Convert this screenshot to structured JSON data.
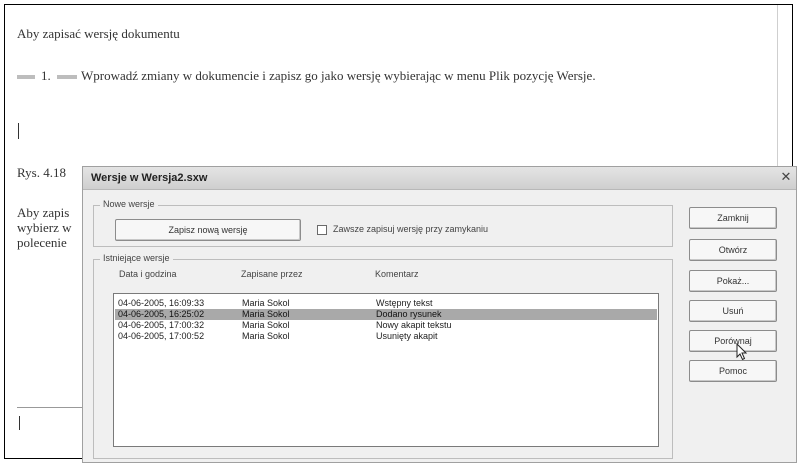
{
  "document": {
    "line1": "Aby zapisać wersję dokumentu",
    "step_number": "1.",
    "step_text": "Wprowadź zmiany w dokumencie i zapisz go jako wersję wybierając w menu Plik pozycję Wersje.",
    "figure_caption": "Rys. 4.18",
    "para2_line1": "Aby zapis",
    "para2_line2": "wybierz w",
    "para2_line3": "polecenie"
  },
  "dialog": {
    "title": "Wersje w Wersja2.sxw",
    "close_glyph": "✕",
    "new_group_label": "Nowe wersje",
    "save_new_button": "Zapisz nową wersję",
    "autosave_label": "Zawsze zapisuj wersję przy zamykaniu",
    "autosave_checked": false,
    "existing_group_label": "Istniejące wersje",
    "columns": {
      "date": "Data i godzina",
      "by": "Zapisane przez",
      "comment": "Komentarz"
    },
    "rows": [
      {
        "date": "04-06-2005, 16:09:33",
        "by": "Maria Sokol",
        "comment": "Wstępny tekst",
        "selected": false
      },
      {
        "date": "04-06-2005, 16:25:02",
        "by": "Maria Sokol",
        "comment": "Dodano rysunek",
        "selected": true
      },
      {
        "date": "04-06-2005, 17:00:32",
        "by": "Maria Sokol",
        "comment": "Nowy akapit tekstu",
        "selected": false
      },
      {
        "date": "04-06-2005, 17:00:52",
        "by": "Maria Sokol",
        "comment": "Usunięty akapit",
        "selected": false
      }
    ],
    "buttons": {
      "close": "Zamknij",
      "open": "Otwórz",
      "show": "Pokaż...",
      "delete": "Usuń",
      "compare": "Porównaj",
      "help": "Pomoc"
    }
  }
}
